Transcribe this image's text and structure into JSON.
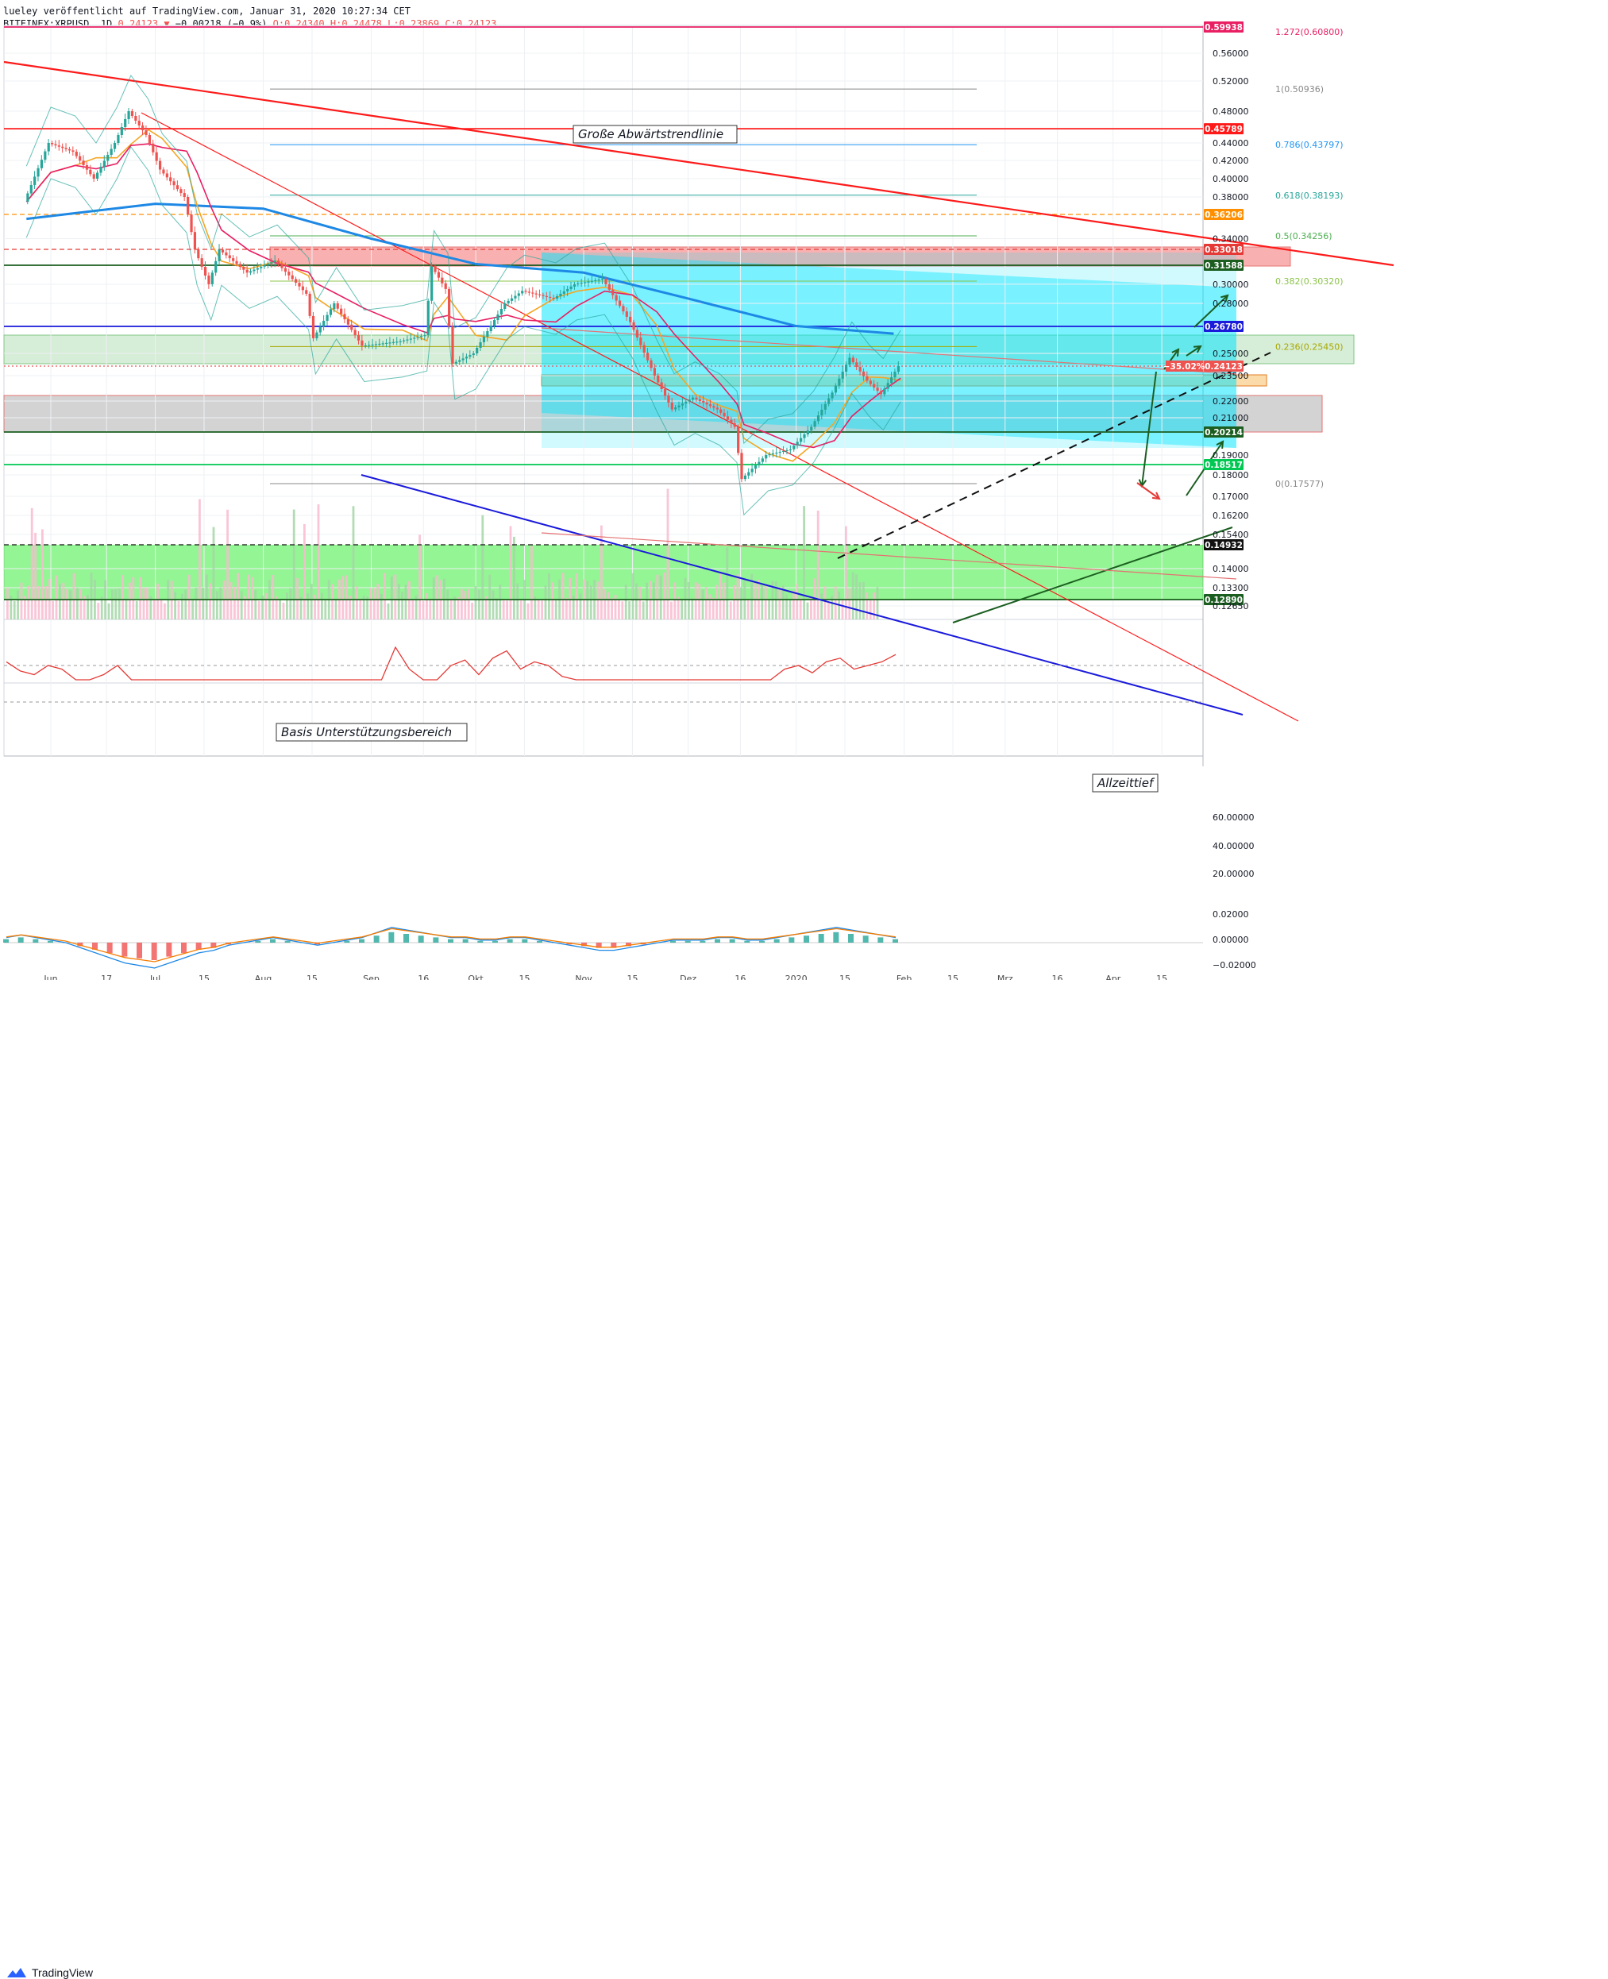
{
  "header": {
    "line1": "lueley veröffentlicht auf TradingView.com, Januar 31, 2020 10:27:34 CET",
    "symbol": "BITFINEX:XRPUSD, 1D",
    "last": "0.24123",
    "change_arrow": "▼",
    "change": "−0.00218 (−0.9%)",
    "ohlc": "O:0.24340 H:0.24478 L:0.23869 C:0.24123"
  },
  "footer": {
    "brand": "TradingView",
    "logo_icon": "tradingview-logo-icon"
  },
  "colors": {
    "up": "#26a69a",
    "down": "#ef5350",
    "ma200": "#1e88e5",
    "ema_fast": "#f5a623",
    "ema_slow": "#e91e63",
    "channel_fill": "#00e5ff",
    "support_fill": "#00e600",
    "resistance_fill": "#ef5350",
    "gray_zone": "#9e9e9e",
    "orange_zone": "#f5b041"
  },
  "chart_data": {
    "type": "candlestick",
    "title": "",
    "price_axis": {
      "ticks": [
        "0.56000",
        "0.52000",
        "0.48000",
        "0.44000",
        "0.42000",
        "0.40000",
        "0.38000",
        "0.34000",
        "0.30000",
        "0.28000",
        "0.25000",
        "0.23500",
        "0.22000",
        "0.21000",
        "0.19000",
        "0.18000",
        "0.17000",
        "0.16200",
        "0.15400",
        "0.14000",
        "0.13300",
        "0.12650"
      ]
    },
    "time_axis": {
      "labels": [
        {
          "label": "Jun",
          "date": "2019-06-01"
        },
        {
          "label": "17",
          "date": "2019-06-17"
        },
        {
          "label": "Jul",
          "date": "2019-07-01"
        },
        {
          "label": "15",
          "date": "2019-07-15"
        },
        {
          "label": "Aug",
          "date": "2019-08-01"
        },
        {
          "label": "15",
          "date": "2019-08-15"
        },
        {
          "label": "Sep",
          "date": "2019-09-01"
        },
        {
          "label": "16",
          "date": "2019-09-16"
        },
        {
          "label": "Okt",
          "date": "2019-10-01"
        },
        {
          "label": "15",
          "date": "2019-10-15"
        },
        {
          "label": "Nov",
          "date": "2019-11-01"
        },
        {
          "label": "15",
          "date": "2019-11-15"
        },
        {
          "label": "Dez",
          "date": "2019-12-01"
        },
        {
          "label": "16",
          "date": "2019-12-16"
        },
        {
          "label": "2020",
          "date": "2020-01-01"
        },
        {
          "label": "15",
          "date": "2020-01-15"
        },
        {
          "label": "Feb",
          "date": "2020-02-01"
        },
        {
          "label": "15",
          "date": "2020-02-15"
        },
        {
          "label": "Mrz",
          "date": "2020-03-01"
        },
        {
          "label": "16",
          "date": "2020-03-16"
        },
        {
          "label": "Apr",
          "date": "2020-04-01"
        },
        {
          "label": "15",
          "date": "2020-04-15"
        }
      ]
    },
    "price_path": [
      {
        "date": "2019-05-25",
        "price": 0.375
      },
      {
        "date": "2019-06-01",
        "price": 0.44
      },
      {
        "date": "2019-06-08",
        "price": 0.43
      },
      {
        "date": "2019-06-14",
        "price": 0.4
      },
      {
        "date": "2019-06-20",
        "price": 0.44
      },
      {
        "date": "2019-06-24",
        "price": 0.48
      },
      {
        "date": "2019-06-29",
        "price": 0.45
      },
      {
        "date": "2019-07-03",
        "price": 0.41
      },
      {
        "date": "2019-07-10",
        "price": 0.38
      },
      {
        "date": "2019-07-13",
        "price": 0.33
      },
      {
        "date": "2019-07-17",
        "price": 0.3
      },
      {
        "date": "2019-07-20",
        "price": 0.33
      },
      {
        "date": "2019-07-28",
        "price": 0.31
      },
      {
        "date": "2019-08-05",
        "price": 0.32
      },
      {
        "date": "2019-08-14",
        "price": 0.29
      },
      {
        "date": "2019-08-16",
        "price": 0.26
      },
      {
        "date": "2019-08-22",
        "price": 0.28
      },
      {
        "date": "2019-08-30",
        "price": 0.255
      },
      {
        "date": "2019-09-10",
        "price": 0.258
      },
      {
        "date": "2019-09-17",
        "price": 0.262
      },
      {
        "date": "2019-09-19",
        "price": 0.315
      },
      {
        "date": "2019-09-23",
        "price": 0.295
      },
      {
        "date": "2019-09-25",
        "price": 0.243
      },
      {
        "date": "2019-10-01",
        "price": 0.25
      },
      {
        "date": "2019-10-10",
        "price": 0.28
      },
      {
        "date": "2019-10-15",
        "price": 0.293
      },
      {
        "date": "2019-10-24",
        "price": 0.285
      },
      {
        "date": "2019-10-30",
        "price": 0.3
      },
      {
        "date": "2019-11-07",
        "price": 0.305
      },
      {
        "date": "2019-11-15",
        "price": 0.27
      },
      {
        "date": "2019-11-22",
        "price": 0.235
      },
      {
        "date": "2019-11-27",
        "price": 0.215
      },
      {
        "date": "2019-12-03",
        "price": 0.222
      },
      {
        "date": "2019-12-10",
        "price": 0.215
      },
      {
        "date": "2019-12-15",
        "price": 0.205
      },
      {
        "date": "2019-12-17",
        "price": 0.178
      },
      {
        "date": "2019-12-24",
        "price": 0.19
      },
      {
        "date": "2019-12-31",
        "price": 0.193
      },
      {
        "date": "2020-01-06",
        "price": 0.205
      },
      {
        "date": "2020-01-12",
        "price": 0.225
      },
      {
        "date": "2020-01-17",
        "price": 0.247
      },
      {
        "date": "2020-01-22",
        "price": 0.232
      },
      {
        "date": "2020-01-26",
        "price": 0.224
      },
      {
        "date": "2020-01-31",
        "price": 0.24123
      }
    ],
    "ma200": [
      {
        "date": "2019-05-25",
        "price": 0.358
      },
      {
        "date": "2019-07-01",
        "price": 0.373
      },
      {
        "date": "2019-08-01",
        "price": 0.368
      },
      {
        "date": "2019-09-01",
        "price": 0.34
      },
      {
        "date": "2019-10-01",
        "price": 0.317
      },
      {
        "date": "2019-11-01",
        "price": 0.31
      },
      {
        "date": "2019-12-01",
        "price": 0.285
      },
      {
        "date": "2020-01-01",
        "price": 0.268
      },
      {
        "date": "2020-01-29",
        "price": 0.263
      }
    ],
    "horizontal_levels": [
      {
        "price": 0.59938,
        "label": "0.59938",
        "color": "#e91e63"
      },
      {
        "price": 0.45789,
        "label": "0.45789",
        "color": "#ff1a1a"
      },
      {
        "price": 0.36206,
        "label": "0.36206",
        "color": "#ff8f00",
        "dashed": true
      },
      {
        "price": 0.33018,
        "label": "0.33018",
        "color": "#e53935",
        "dashed": true
      },
      {
        "price": 0.31588,
        "label": "0.31588",
        "color": "#1b5e20"
      },
      {
        "price": 0.2678,
        "label": "0.26780",
        "color": "#1a1adb"
      },
      {
        "price": 0.24123,
        "label": "0.24123",
        "color": "#ef5350",
        "dotted": true,
        "pct": "−35.02%"
      },
      {
        "price": 0.20214,
        "label": "0.20214",
        "color": "#1b5e20"
      },
      {
        "price": 0.18517,
        "label": "0.18517",
        "color": "#00c853"
      },
      {
        "price": 0.14932,
        "label": "0.14932",
        "color": "#111111",
        "dashed": true
      },
      {
        "price": 0.1289,
        "label": "0.12890",
        "color": "#1b5e20"
      }
    ],
    "fibonacci": [
      {
        "price": 0.50936,
        "label": "1(0.50936)",
        "color": "#888888"
      },
      {
        "price": 0.43797,
        "label": "0.786(0.43797)",
        "color": "#2196f3"
      },
      {
        "price": 0.38193,
        "label": "0.618(0.38193)",
        "color": "#26a69a"
      },
      {
        "price": 0.34256,
        "label": "0.5(0.34256)",
        "color": "#4caf50"
      },
      {
        "price": 0.3032,
        "label": "0.382(0.30320)",
        "color": "#8bc34a"
      },
      {
        "price": 0.2545,
        "label": "0.236(0.25450)",
        "color": "#a8a800"
      },
      {
        "price": 0.17577,
        "label": "0(0.17577)",
        "color": "#888888"
      }
    ],
    "fib_top_label": "1.272(0.60800)",
    "annotations": {
      "downtrend": "Große Abwärtstrendlinie",
      "support": "Basis Unterstützungsbereich",
      "ath_low": "Allzeittief"
    },
    "rsi": {
      "ticks": [
        "60.00000",
        "40.00000",
        "20.00000"
      ],
      "values": [
        62,
        57,
        55,
        60,
        58,
        50,
        49,
        55,
        60,
        52,
        44,
        38,
        42,
        40,
        46,
        35,
        40,
        38,
        42,
        44,
        47,
        43,
        39,
        41,
        40,
        48,
        52,
        50,
        70,
        58,
        50,
        49,
        60,
        63,
        55,
        64,
        68,
        58,
        62,
        60,
        54,
        46,
        42,
        40,
        36,
        32,
        34,
        36,
        40,
        46,
        44,
        40,
        36,
        38,
        42,
        46,
        58,
        60,
        56,
        62,
        64,
        58,
        60,
        62,
        66
      ]
    },
    "macd": {
      "ticks": [
        "0.02000",
        "0.00000",
        "−0.02000"
      ],
      "hist": [
        2,
        3,
        2,
        1,
        0,
        -2,
        -4,
        -6,
        -8,
        -9,
        -10,
        -8,
        -6,
        -4,
        -3,
        -1,
        0,
        1,
        2,
        1,
        0,
        -1,
        0,
        1,
        2,
        4,
        6,
        5,
        4,
        3,
        2,
        2,
        1,
        1,
        2,
        2,
        1,
        0,
        -1,
        -2,
        -3,
        -3,
        -2,
        -1,
        0,
        1,
        1,
        1,
        2,
        2,
        1,
        1,
        2,
        3,
        4,
        5,
        6,
        5,
        4,
        3,
        2
      ]
    }
  }
}
